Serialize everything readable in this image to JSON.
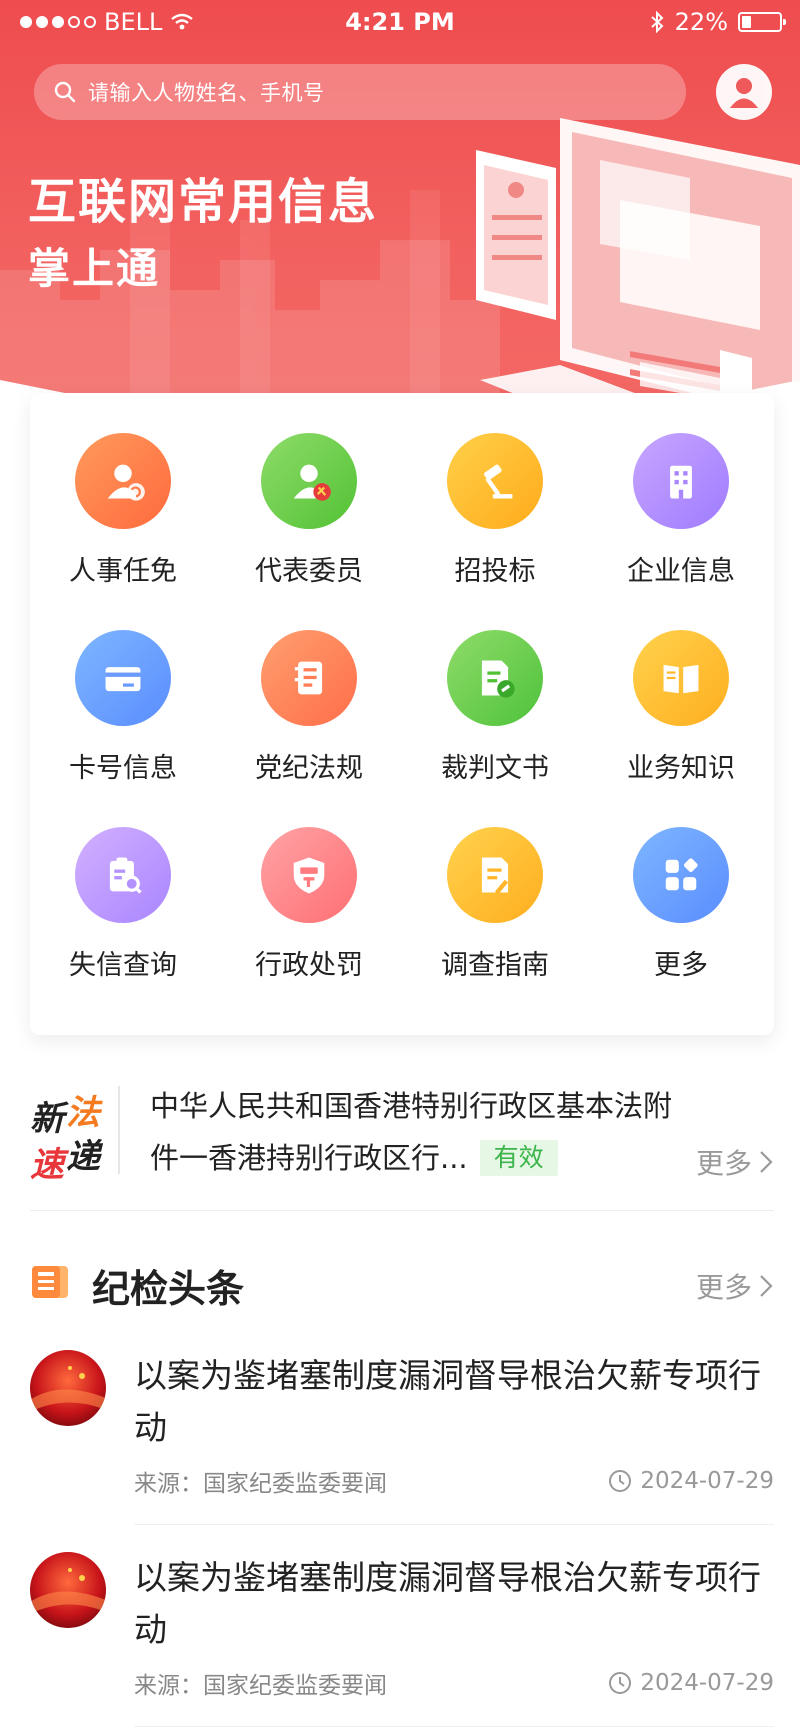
{
  "status_bar": {
    "carrier": "BELL",
    "time": "4:21 PM",
    "battery": "22%"
  },
  "search": {
    "placeholder": "请输入人物姓名、手机号"
  },
  "hero": {
    "title": "互联网常用信息",
    "subtitle": "掌上通"
  },
  "grid": [
    {
      "label": "人事任免",
      "icon": "person-exchange-icon",
      "colors": [
        "#ff9a5c",
        "#ff6a3d"
      ]
    },
    {
      "label": "代表委员",
      "icon": "person-party-icon",
      "colors": [
        "#8fdc6a",
        "#52c234"
      ]
    },
    {
      "label": "招投标",
      "icon": "gavel-icon",
      "colors": [
        "#ffd04a",
        "#ffab1a"
      ]
    },
    {
      "label": "企业信息",
      "icon": "building-icon",
      "colors": [
        "#c8a6ff",
        "#9f7bff"
      ]
    },
    {
      "label": "卡号信息",
      "icon": "card-icon",
      "colors": [
        "#7fb6ff",
        "#5a8dff"
      ]
    },
    {
      "label": "党纪法规",
      "icon": "notebook-icon",
      "colors": [
        "#ff9f6e",
        "#ff6e4a"
      ]
    },
    {
      "label": "裁判文书",
      "icon": "document-gavel-icon",
      "colors": [
        "#8fdc6a",
        "#4fc23b"
      ]
    },
    {
      "label": "业务知识",
      "icon": "book-icon",
      "colors": [
        "#ffd24d",
        "#ffae1f"
      ]
    },
    {
      "label": "失信查询",
      "icon": "clipboard-search-icon",
      "colors": [
        "#d2b1ff",
        "#a985ff"
      ]
    },
    {
      "label": "行政处罚",
      "icon": "shield-penalty-icon",
      "colors": [
        "#ffa3a6",
        "#ff6f73"
      ]
    },
    {
      "label": "调查指南",
      "icon": "document-edit-icon",
      "colors": [
        "#ffd24d",
        "#ffae1f"
      ]
    },
    {
      "label": "更多",
      "icon": "more-apps-icon",
      "colors": [
        "#7fb6ff",
        "#5a8dff"
      ]
    }
  ],
  "ticker": {
    "logo": "新法速递",
    "line1": "中华人民共和国香港特别行政区基本法附",
    "line2": "件一香港持别行政区行...",
    "badge": "有效",
    "more": "更多"
  },
  "section": {
    "title": "纪检头条",
    "more": "更多"
  },
  "news": [
    {
      "title": "以案为鉴堵塞制度漏洞督导根治欠薪专项行动",
      "source_label": "来源：",
      "source": "国家纪委监委要闻",
      "date": "2024-07-29"
    },
    {
      "title": "以案为鉴堵塞制度漏洞督导根治欠薪专项行动",
      "source_label": "来源：",
      "source": "国家纪委监委要闻",
      "date": "2024-07-29"
    }
  ]
}
